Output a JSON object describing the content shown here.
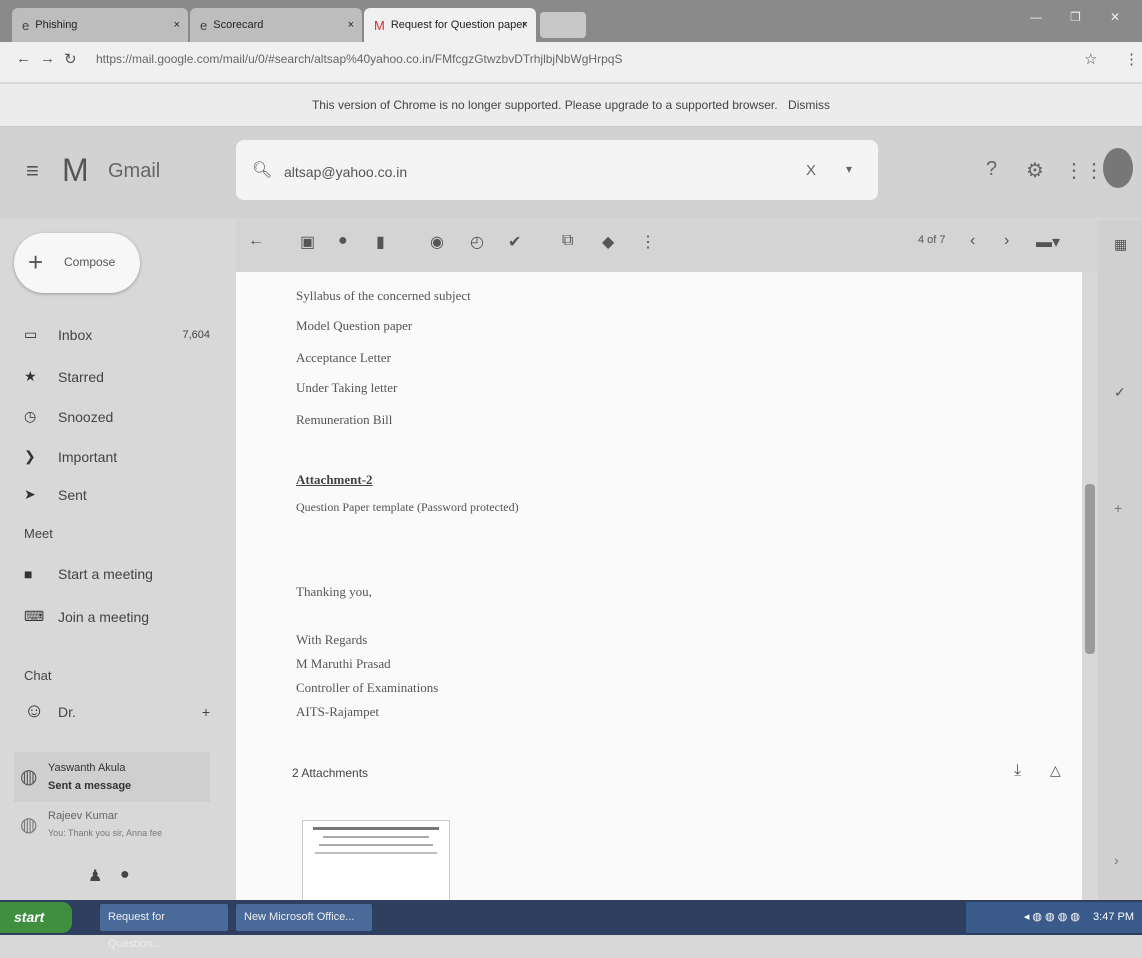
{
  "browser": {
    "tabs": [
      {
        "label": "Phishing"
      },
      {
        "label": "Scorecard"
      },
      {
        "label": "Request for Question paper"
      }
    ],
    "url": "https://mail.google.com/mail/u/0/#search/altsap%40yahoo.co.in/FMfcgzGtwzbvDTrhjlbjNbWgHrpqS",
    "infobar_text": "This version of Chrome is no longer supported. Please upgrade to a supported browser.",
    "infobar_dismiss": "Dismiss"
  },
  "gmail": {
    "brand": "Gmail",
    "search_value": "altsap@yahoo.co.in",
    "search_clear": "X",
    "pagination": "4 of 7"
  },
  "sidebar": {
    "compose_label": "Compose",
    "items": [
      {
        "label": "Inbox",
        "count": "7,604",
        "icon": "inbox-icon"
      },
      {
        "label": "Starred",
        "icon": "star-icon"
      },
      {
        "label": "Snoozed",
        "icon": "clock-icon"
      },
      {
        "label": "Important",
        "icon": "important-icon"
      },
      {
        "label": "Sent",
        "icon": "send-icon"
      }
    ],
    "meet_label": "Meet",
    "meet_items": [
      {
        "label": "Start a meeting",
        "icon": "video-icon"
      },
      {
        "label": "Join a meeting",
        "icon": "keyboard-icon"
      }
    ],
    "chat_label": "Chat",
    "chat_self": "Dr.",
    "chats": [
      {
        "name": "Yaswanth Akula",
        "status": "Sent a message"
      },
      {
        "name": "Rajeev Kumar",
        "status": "You: Thank you sir, Anna fee"
      }
    ]
  },
  "message": {
    "lines": [
      "Syllabus of the concerned subject",
      "Model Question paper",
      "Acceptance Letter",
      "Under Taking letter",
      "Remuneration Bill"
    ],
    "attachment_heading": "Attachment-2",
    "attachment_desc": "Question Paper template (Password protected)",
    "closing": "Thanking you,",
    "signature": [
      "With Regards",
      "M Maruthi Prasad",
      "Controller of Examinations",
      "AITS-Rajampet"
    ],
    "attachments_count": "2 Attachments"
  },
  "taskbar": {
    "start_label": "start",
    "tasks": [
      "Request for Question...",
      "New Microsoft Office..."
    ],
    "clock": "3:47 PM"
  }
}
